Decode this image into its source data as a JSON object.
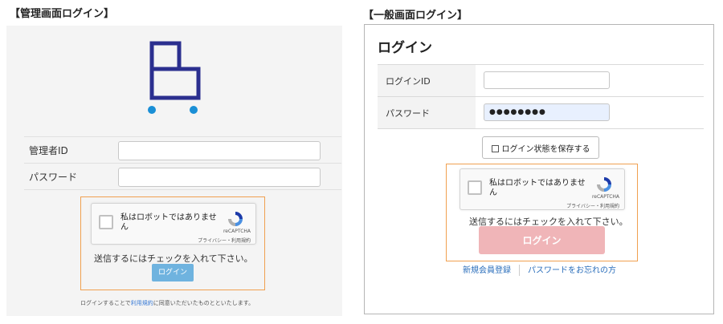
{
  "admin": {
    "heading": "【管理画面ログイン】",
    "fields": [
      {
        "label": "管理者ID",
        "value": ""
      },
      {
        "label": "パスワード",
        "value": ""
      }
    ],
    "recaptcha": {
      "checkbox_text": "私はロボットではありません",
      "brand": "reCAPTCHA",
      "links": "プライバシー・利用規約"
    },
    "note": "送信するにはチェックを入れて下さい。",
    "login_button": "ログイン",
    "agree_prefix": "ログインすることで",
    "agree_link": "利用規約",
    "agree_suffix": "に同意いただいたものとといたします。"
  },
  "user": {
    "heading": "【一般画面ログイン】",
    "title": "ログイン",
    "fields": [
      {
        "label": "ログインID",
        "value": ""
      },
      {
        "label": "パスワード",
        "value": "●●●●●●●●"
      }
    ],
    "save_button": "ログイン状態を保存する",
    "recaptcha": {
      "checkbox_text": "私はロボットではありません",
      "brand": "reCAPTCHA",
      "links": "プライバシー・利用規約"
    },
    "note": "送信するにはチェックを入れて下さい。",
    "login_button": "ログイン",
    "register_link": "新規会員登録",
    "forgot_link": "パスワードをお忘れの方"
  },
  "colors": {
    "logo": "#2b2f8f",
    "logo_dot": "#1a8fd6",
    "accent_orange": "#f0a050",
    "admin_button": "#6fb3df",
    "user_button": "#f0b5b8"
  },
  "icons": {
    "logo": "cart-logo-icon",
    "recaptcha": "recaptcha-icon",
    "save": "checkbox-square-icon"
  }
}
